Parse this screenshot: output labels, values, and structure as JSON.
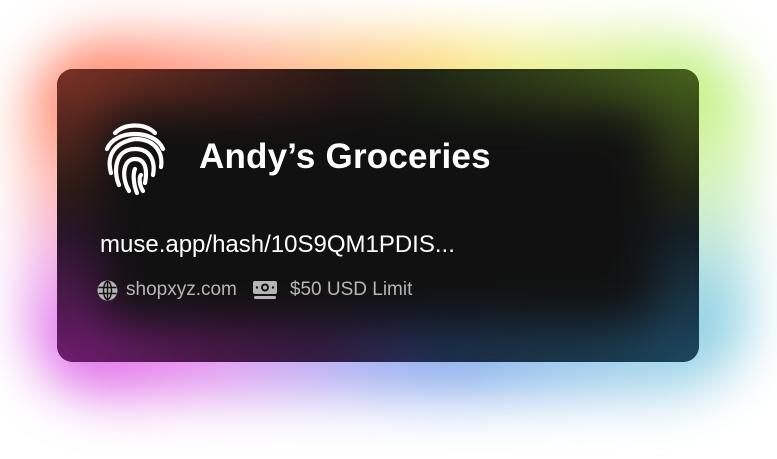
{
  "card": {
    "merchant_name": "Andy’s Groceries",
    "hash_url": "muse.app/hash/10S9QM1PDIS...",
    "domain": "shopxyz.com",
    "limit": "$50 USD Limit"
  },
  "icons": {
    "auth": "fingerprint-icon",
    "site": "globe-icon",
    "limit": "money-icon"
  },
  "colors": {
    "card_background": "#121212",
    "primary_text": "#ffffff",
    "secondary_text": "#b5b5b5"
  }
}
